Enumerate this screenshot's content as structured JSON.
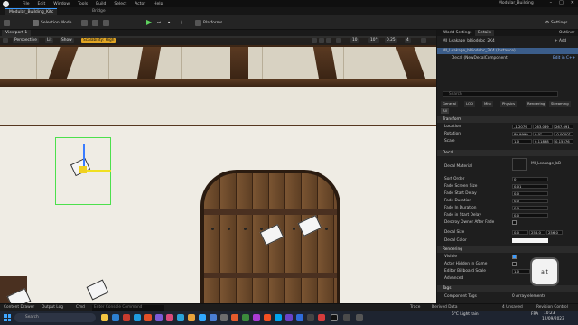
{
  "titlebar": {
    "menu": [
      "File",
      "Edit",
      "Window",
      "Tools",
      "Build",
      "Select",
      "Actor",
      "Help"
    ],
    "project_name": "Modular_Building"
  },
  "tabs": {
    "level_tab": "Modular_Building_Kitc",
    "bridge_tab": "Bridge"
  },
  "toolbar": {
    "selection_mode": "Selection Mode",
    "platforms": "Platforms",
    "settings": "Settings"
  },
  "viewport": {
    "tab_label": "Viewport 1",
    "perspective": "Perspective",
    "lit": "Lit",
    "show": "Show",
    "scalability": "Scalability: High",
    "grid_value": "10",
    "rot_value": "10°",
    "scale_value": "0.25",
    "cam_speed": "4"
  },
  "details": {
    "world_settings_tab": "World Settings",
    "details_tab": "Details",
    "outliner_tab": "Outliner",
    "actor_name": "MI_Leakage_bBiodebc_2K4",
    "add_button": "+ Add",
    "instance_label": "MI_Leakage_bBiodebc_2K4 (Instance)",
    "component_label": "Decal (NewDecalComponent)",
    "edit_in_cpp": "Edit in C++",
    "search_placeholder": "Search",
    "category_tabs": [
      "General",
      "LOD",
      "Misc",
      "Physics",
      "Rendering",
      "Streaming",
      "All"
    ],
    "transform_header": "Transform",
    "location_label": "Location",
    "location": [
      "-1.2079",
      "263.089",
      "267.691"
    ],
    "rotation_label": "Rotation",
    "rotation": [
      "89.9999",
      "0.0°",
      "-0.0000°"
    ],
    "scale_label": "Scale",
    "scale": [
      "1.0",
      "0.11838",
      "0.15576"
    ],
    "decal_header": "Decal",
    "decal_material_label": "Decal Material",
    "decal_material_value": "MI_Leakage_bB",
    "sort_order_label": "Sort Order",
    "sort_order_value": "0",
    "fade_screen_size_label": "Fade Screen Size",
    "fade_screen_size_value": "0.01",
    "fade_start_delay_label": "Fade Start Delay",
    "fade_start_delay_value": "0.0",
    "fade_duration_label": "Fade Duration",
    "fade_duration_value": "0.0",
    "fade_in_duration_label": "Fade In Duration",
    "fade_in_duration_value": "0.0",
    "fade_in_start_delay_label": "Fade in Start Delay",
    "fade_in_start_delay_value": "0.0",
    "destroy_owner_label": "Destroy Owner After Fade",
    "decal_size_label": "Decal Size",
    "decal_size": [
      "0.0",
      "256.0",
      "256.0"
    ],
    "decal_color_label": "Decal Color",
    "rendering_header": "Rendering",
    "visible_label": "Visible",
    "actor_hidden_label": "Actor Hidden in Game",
    "editor_billboard_label": "Editor Billboard Scale",
    "editor_billboard_value": "1.0",
    "advanced_label": "Advanced",
    "tags_header": "Tags",
    "component_tags_label": "Component Tags",
    "component_tags_value": "0 Array elements"
  },
  "alt_key": "alt",
  "statusbar": {
    "content_drawer": "Content Drawer",
    "output_log": "Output Log",
    "cmd": "Cmd",
    "console_placeholder": "Enter Console Command",
    "trace": "Trace",
    "derived_data": "Derived Data",
    "unsaved": "4 Unsaved",
    "revision_control": "Revision Control"
  },
  "taskbar": {
    "search_placeholder": "Search",
    "weather": "6°C Light rain",
    "lang": "FRA",
    "time": "10:23",
    "date": "12/09/2023"
  },
  "colors": {
    "accent": "#3a9bff",
    "selection": "#4ce04c",
    "scalability": "#e2a623"
  }
}
